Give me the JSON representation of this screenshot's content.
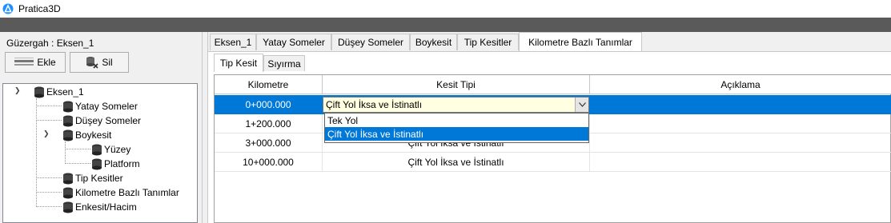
{
  "window": {
    "title": "Pratica3D",
    "accent": "#1e90ff"
  },
  "left_panel": {
    "route_label": "Güzergah : Eksen_1",
    "add_button": "Ekle",
    "delete_button": "Sil",
    "tree": {
      "root": "Eksen_1",
      "items": {
        "yatay": "Yatay Someler",
        "dusey": "Düşey Someler",
        "boykesit": "Boykesit",
        "yuzey": "Yüzey",
        "platform": "Platform",
        "tip": "Tip Kesitler",
        "km": "Kilometre Bazlı Tanımlar",
        "enkesit": "Enkesit/Hacim"
      }
    }
  },
  "tabs": [
    "Eksen_1",
    "Yatay Someler",
    "Düşey Someler",
    "Boykesit",
    "Tip Kesitler",
    "Kilometre Bazlı Tanımlar"
  ],
  "active_tab": "Kilometre Bazlı Tanımlar",
  "subtabs": [
    "Tip Kesit",
    "Sıyırma"
  ],
  "active_subtab": "Tip Kesit",
  "grid": {
    "headers": {
      "km": "Kilometre",
      "type": "Kesit Tipi",
      "desc": "Açıklama"
    },
    "rows": [
      {
        "km": "0+000.000",
        "type": "Çift Yol İksa ve İstinatlı",
        "desc": ""
      },
      {
        "km": "1+200.000",
        "type": "Çift Yol İksa ve İstinatlı",
        "desc": ""
      },
      {
        "km": "3+000.000",
        "type": "Çift Yol İksa ve İstinatlı",
        "desc": ""
      },
      {
        "km": "10+000.000",
        "type": "Çift Yol İksa ve İstinatlı",
        "desc": ""
      }
    ],
    "selected_row": 0
  },
  "combo": {
    "value": "Çift Yol İksa ve İstinatlı",
    "options": [
      "Tek Yol",
      "Çift Yol İksa ve İstinatlı"
    ],
    "highlighted_option": "Çift Yol İksa ve İstinatlı"
  },
  "colors": {
    "selection": "#0078d7",
    "combo_bg": "#ffffe1",
    "dark_bar": "#5a5a5a"
  }
}
